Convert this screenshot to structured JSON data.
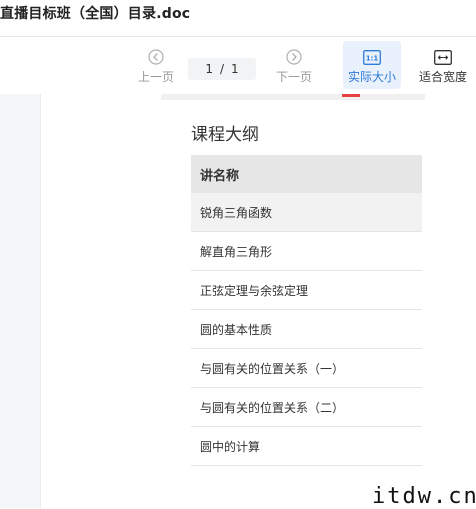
{
  "window": {
    "title": "直播目标班（全国）目录.doc"
  },
  "toolbar": {
    "prev_label": "上一页",
    "current_page": "1",
    "page_separator": "/",
    "total_pages": "1",
    "next_label": "下一页",
    "actual_size_label": "实际大小",
    "actual_size_icon_text": "1:1",
    "fit_width_label": "适合宽度"
  },
  "document": {
    "heading": "课程大纲",
    "table_header": "讲名称",
    "rows": [
      "锐角三角函数",
      "解直角三角形",
      "正弦定理与余弦定理",
      "圆的基本性质",
      "与圆有关的位置关系（一）",
      "与圆有关的位置关系（二）",
      "圆中的计算"
    ]
  },
  "watermark": "itdw.cn",
  "colors": {
    "accent": "#2f7bd8",
    "active_bg": "#e8f1fc",
    "marker": "#e64340"
  },
  "icons": {
    "prev": "chevron-left-circle-icon",
    "next": "chevron-right-circle-icon",
    "actual_size": "one-to-one-icon",
    "fit_width": "fit-width-icon"
  }
}
